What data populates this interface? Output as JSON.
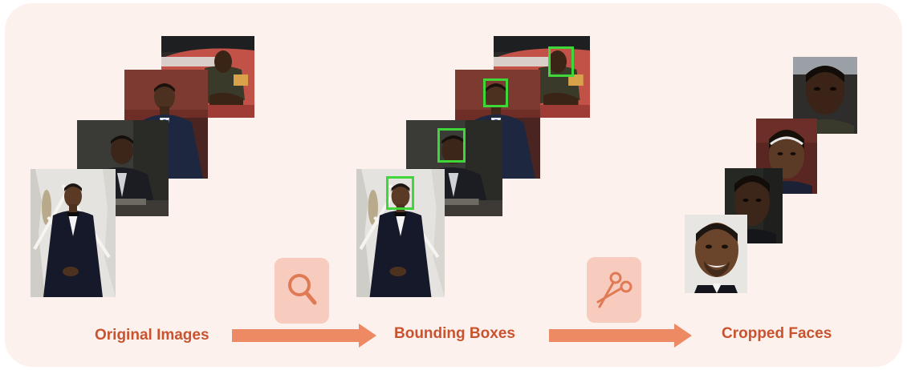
{
  "diagram": {
    "stages": [
      {
        "label": "Original Images"
      },
      {
        "label": "Bounding Boxes"
      },
      {
        "label": "Cropped Faces"
      }
    ],
    "icons": [
      "magnifier-icon",
      "scissors-icon"
    ],
    "colors": {
      "panel_bg": "#fdf1ee",
      "accent": "#c9532e",
      "arrow": "#ee8a63",
      "icon_tile": "#f7cbbd",
      "bounding_box": "#3fd63a"
    }
  }
}
